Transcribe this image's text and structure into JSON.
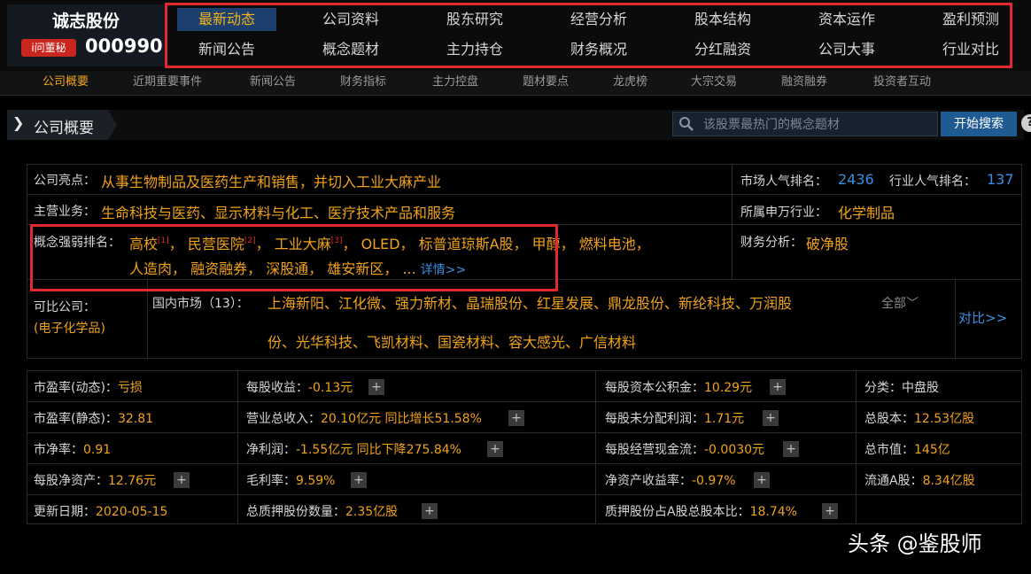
{
  "stock": {
    "name": "诚志股份",
    "code": "000990",
    "wen_label": "i问董秘"
  },
  "top_nav": {
    "row1": [
      "最新动态",
      "公司资料",
      "股东研究",
      "经营分析",
      "股本结构",
      "资本运作",
      "盈利预测"
    ],
    "row2": [
      "新闻公告",
      "概念题材",
      "主力持仓",
      "财务概况",
      "分红融资",
      "公司大事",
      "行业对比"
    ]
  },
  "sub_nav": [
    "公司概要",
    "近期重要事件",
    "新闻公告",
    "财务指标",
    "主力控盘",
    "题材要点",
    "龙虎榜",
    "大宗交易",
    "融资融券",
    "投资者互动"
  ],
  "section": {
    "title": "公司概要"
  },
  "search": {
    "placeholder": "该股票最热门的概念题材",
    "button": "开始搜索",
    "help": "?"
  },
  "overview": {
    "highlight_label": "公司亮点：",
    "highlight": "从事生物制品及医药生产和销售，并切入工业大麻产业",
    "business_label": "主营业务：",
    "business": "生命科技与医药、显示材料与化工、医疗技术产品和服务",
    "concept_label": "概念强弱排名：",
    "concepts_line1": [
      {
        "text": "高校",
        "sup": "[1]"
      },
      {
        "text": "民营医院",
        "sup": "[2]"
      },
      {
        "text": "工业大麻",
        "sup": "[3]"
      },
      {
        "text": "OLED",
        "sup": ""
      },
      {
        "text": "标普道琼斯A股",
        "sup": ""
      },
      {
        "text": "甲醇",
        "sup": ""
      },
      {
        "text": "燃料电池",
        "sup": ""
      }
    ],
    "concepts_line2": [
      "人造肉",
      "融资融券",
      "深股通",
      "雄安新区"
    ],
    "ellipsis": "...",
    "detail_link": "详情>>",
    "market_rank_label": "市场人气排名：",
    "market_rank": "2436",
    "industry_rank_label": "行业人气排名：",
    "industry_rank": "137",
    "sw_industry_label": "所属申万行业：",
    "sw_industry": "化学制品",
    "fin_analysis_label": "财务分析：",
    "fin_analysis": "破净股",
    "comparable_label": "可比公司：",
    "comparable_cat": "(电子化学品)",
    "domestic_label": "国内市场（13）：",
    "comparable_line1": "上海新阳、江化微、强力新材、晶瑞股份、红星发展、鼎龙股份、新纶科技、万润股",
    "comparable_line2": "份、光华科技、飞凯材料、国瓷材料、容大感光、广信材料",
    "all_label": "全部",
    "compare_link": "对比>>"
  },
  "metrics": [
    [
      {
        "label": "市盈率(动态)：",
        "value": "亏损"
      },
      {
        "label": "市盈率(静态)：",
        "value": "32.81"
      },
      {
        "label": "市净率：",
        "value": "0.91"
      },
      {
        "label": "每股净资产：",
        "value": "12.76元",
        "plus": true
      },
      {
        "label": "更新日期：",
        "value": "2020-05-15"
      }
    ],
    [
      {
        "label": "每股收益：",
        "value": "-0.13元",
        "plus": true
      },
      {
        "label": "营业总收入：",
        "value": "20.10亿元 同比增长51.58%",
        "plus": true
      },
      {
        "label": "净利润：",
        "value": "-1.55亿元 同比下降275.84%",
        "plus": true
      },
      {
        "label": "毛利率：",
        "value": "9.59%",
        "plus": true
      },
      {
        "label": "总质押股份数量：",
        "value": "2.35亿股",
        "plus": true
      }
    ],
    [
      {
        "label": "每股资本公积金：",
        "value": "10.29元",
        "plus": true
      },
      {
        "label": "每股未分配利润：",
        "value": "1.71元",
        "plus": true
      },
      {
        "label": "每股经营现金流：",
        "value": "-0.0030元",
        "plus": true
      },
      {
        "label": "净资产收益率：",
        "value": "-0.97%",
        "plus": true
      },
      {
        "label": "质押股份占A股总股本比：",
        "value": "18.74%",
        "plus": true
      }
    ],
    [
      {
        "label": "分类：",
        "value": "中盘股"
      },
      {
        "label": "总股本：",
        "value": "12.53亿股"
      },
      {
        "label": "总市值：",
        "value": "145亿"
      },
      {
        "label": "流通A股：",
        "value": "8.34亿股"
      }
    ]
  ],
  "watermark": "头条 @鉴股师"
}
